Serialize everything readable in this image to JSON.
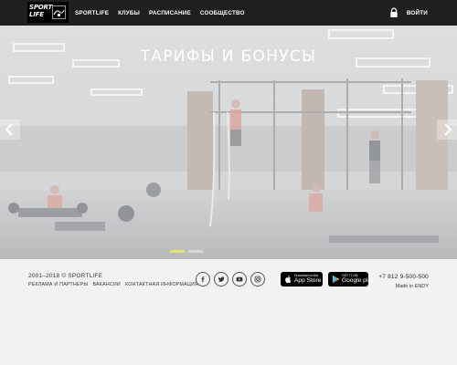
{
  "header": {
    "logo": {
      "line1": "SPORT",
      "line2": "LIFE"
    },
    "nav": [
      "SPORTLIFE",
      "КЛУБЫ",
      "РАСПИСАНИЕ",
      "СООБЩЕСТВО"
    ],
    "login_label": "ВОЙТИ",
    "login_icon": "lock-icon"
  },
  "hero": {
    "title": "ТАРИФЫ И БОНУСЫ",
    "prev_icon": "chevron-left-icon",
    "next_icon": "chevron-right-icon",
    "slide_count": 2,
    "active_slide": 1
  },
  "footer": {
    "copyright": "2001–2018 © SPORTLIFE",
    "links": [
      "РЕКЛАМА И ПАРТНЕРЫ",
      "ВАКАНСИИ",
      "КОНТАКТНАЯ ИНФОРМАЦИЯ"
    ],
    "social": [
      "facebook-icon",
      "twitter-icon",
      "youtube-icon",
      "instagram-icon"
    ],
    "app_store": {
      "small": "Download on the",
      "big": "App Store"
    },
    "google_play": {
      "small": "GET IT ON",
      "big": "Google play"
    },
    "phone": "+7 812 9-500-500",
    "made_in": "Made in ENDY"
  },
  "colors": {
    "header_bg": "#1d1f21",
    "active_dot": "#e6e27a",
    "footer_bg": "#f2f2f2"
  }
}
